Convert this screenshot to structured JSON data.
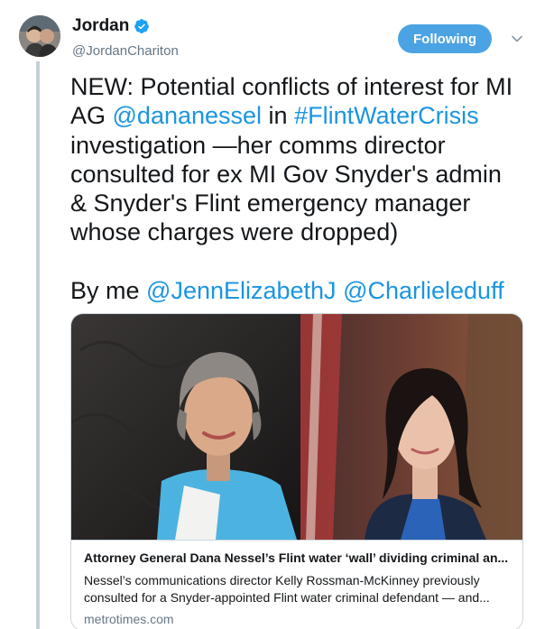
{
  "tweet": {
    "author": {
      "display_name": "Jordan",
      "handle": "@JordanChariton",
      "verified_icon": "verified-badge-icon"
    },
    "follow_button_label": "Following",
    "menu_icon": "chevron-down-icon",
    "text_lines": [
      [
        {
          "t": "NEW: Potential conflicts of interest for MI",
          "link": false
        }
      ],
      [
        {
          "t": "AG ",
          "link": false
        },
        {
          "t": "@dananessel",
          "link": true
        },
        {
          "t": " in ",
          "link": false
        },
        {
          "t": "#FlintWaterCrisis",
          "link": true
        }
      ],
      [
        {
          "t": "investigation —her comms director",
          "link": false
        }
      ],
      [
        {
          "t": "consulted for ex MI Gov Snyder's admin",
          "link": false
        }
      ],
      [
        {
          "t": "& Snyder's Flint emergency manager",
          "link": false
        }
      ],
      [
        {
          "t": "whose charges were dropped)",
          "link": false
        }
      ]
    ],
    "byline": [
      {
        "t": "By me ",
        "link": false
      },
      {
        "t": "@JennElizabethJ",
        "link": true
      },
      {
        "t": " ",
        "link": false
      },
      {
        "t": "@Charlieleduff",
        "link": true
      }
    ]
  },
  "card": {
    "title": "Attorney General Dana Nessel’s Flint water ‘wall’ dividing criminal an...",
    "description_lines": [
      "Nessel’s communications director Kelly Rossman-McKinney previously",
      "consulted for a Snyder-appointed Flint water criminal defendant — and..."
    ],
    "domain": "metrotimes.com"
  },
  "colors": {
    "link": "#1b95e0",
    "follow_button": "#4ba3e3",
    "secondary_text": "#657786",
    "thread_line": "#c4cfd6"
  }
}
